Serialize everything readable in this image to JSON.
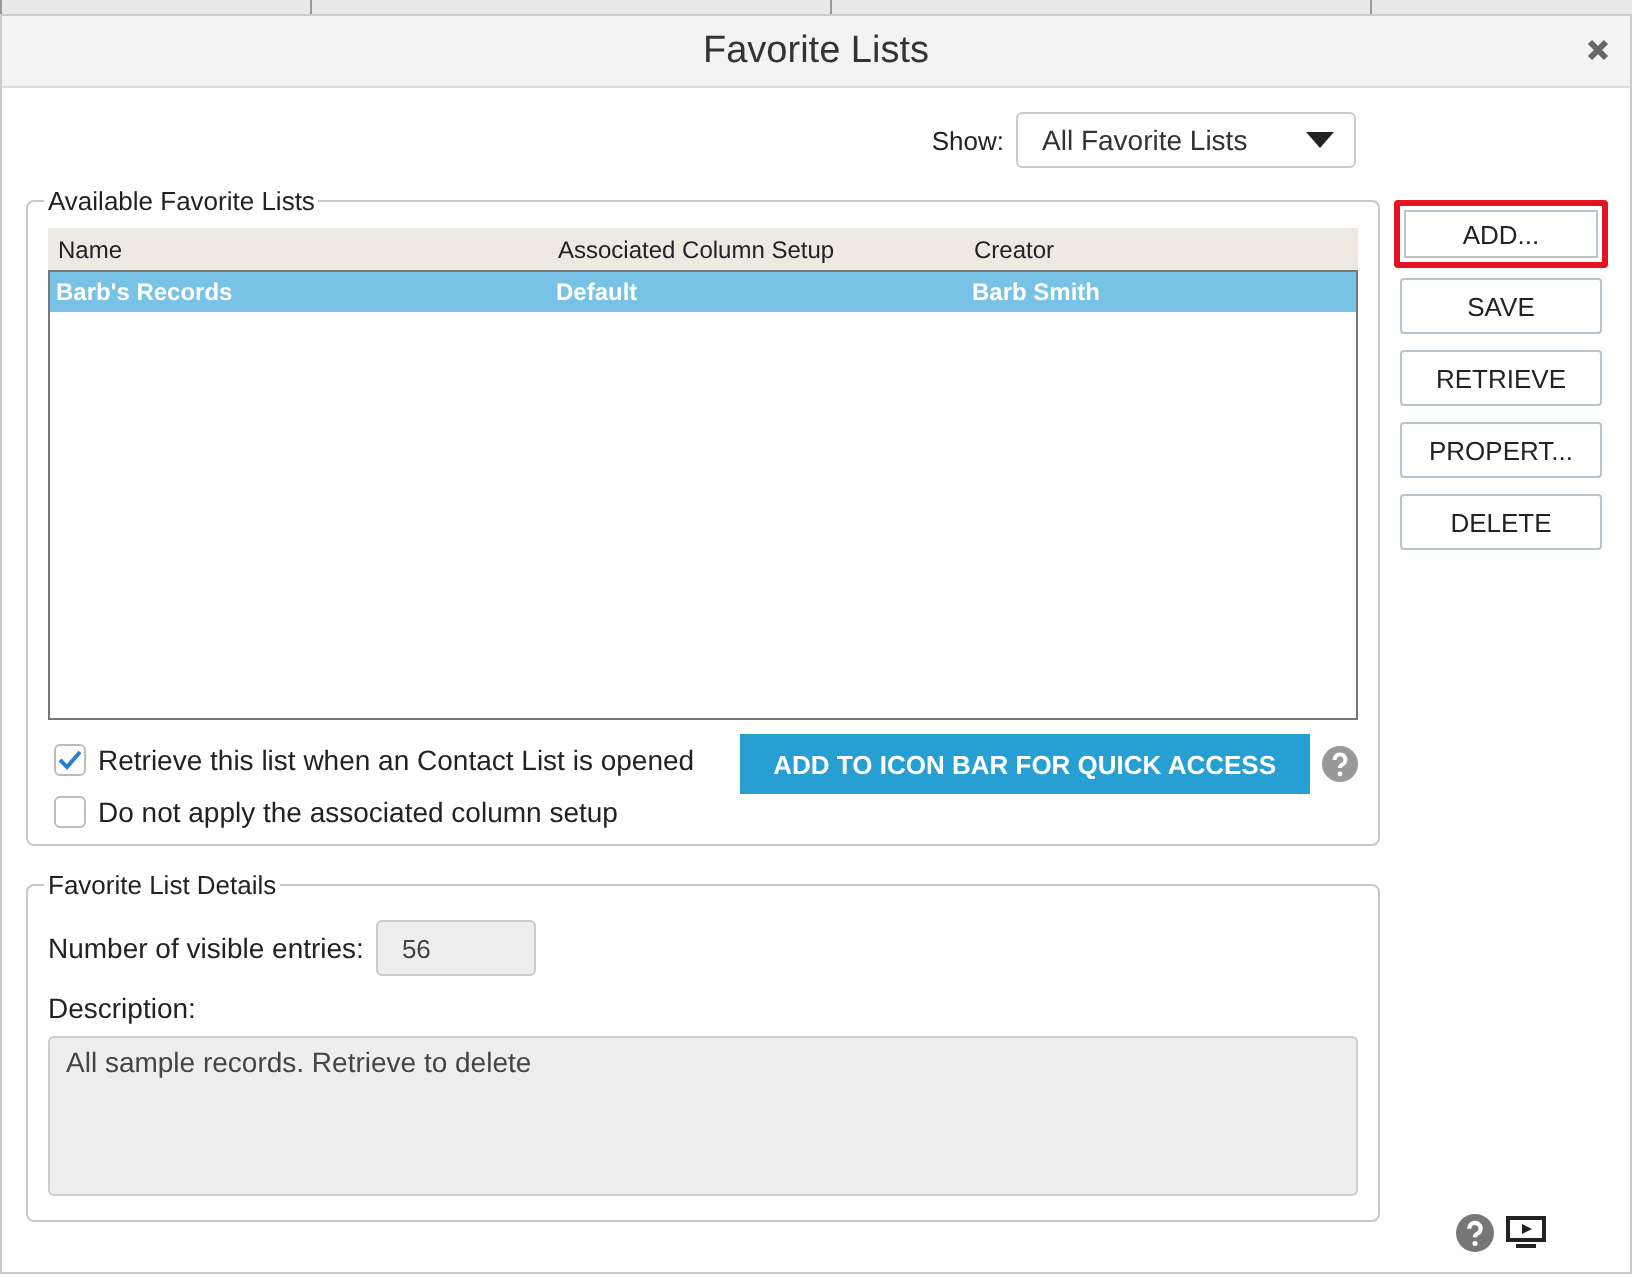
{
  "window": {
    "title": "Favorite Lists"
  },
  "show": {
    "label": "Show:",
    "value": "All Favorite Lists"
  },
  "available": {
    "legend": "Available Favorite Lists",
    "columns": [
      "Name",
      "Associated Column Setup",
      "Creator"
    ],
    "rows": [
      {
        "cells": [
          "Barb's Records",
          "Default",
          "Barb Smith"
        ],
        "selected": true
      }
    ],
    "options": [
      {
        "label": "Retrieve this list when an Contact List is opened",
        "checked": true
      },
      {
        "label": "Do not apply the associated column setup",
        "checked": false
      }
    ],
    "icon_bar_button": "ADD TO ICON BAR FOR QUICK ACCESS"
  },
  "buttons": [
    {
      "label": "ADD...",
      "highlighted": true
    },
    {
      "label": "SAVE",
      "highlighted": false
    },
    {
      "label": "RETRIEVE",
      "highlighted": false
    },
    {
      "label": "PROPERT...",
      "highlighted": false
    },
    {
      "label": "DELETE",
      "highlighted": false
    }
  ],
  "details": {
    "legend": "Favorite List Details",
    "entries_label": "Number of visible entries:",
    "entries_value": "56",
    "description_label": "Description:",
    "description_value": "All sample records. Retrieve to delete"
  }
}
